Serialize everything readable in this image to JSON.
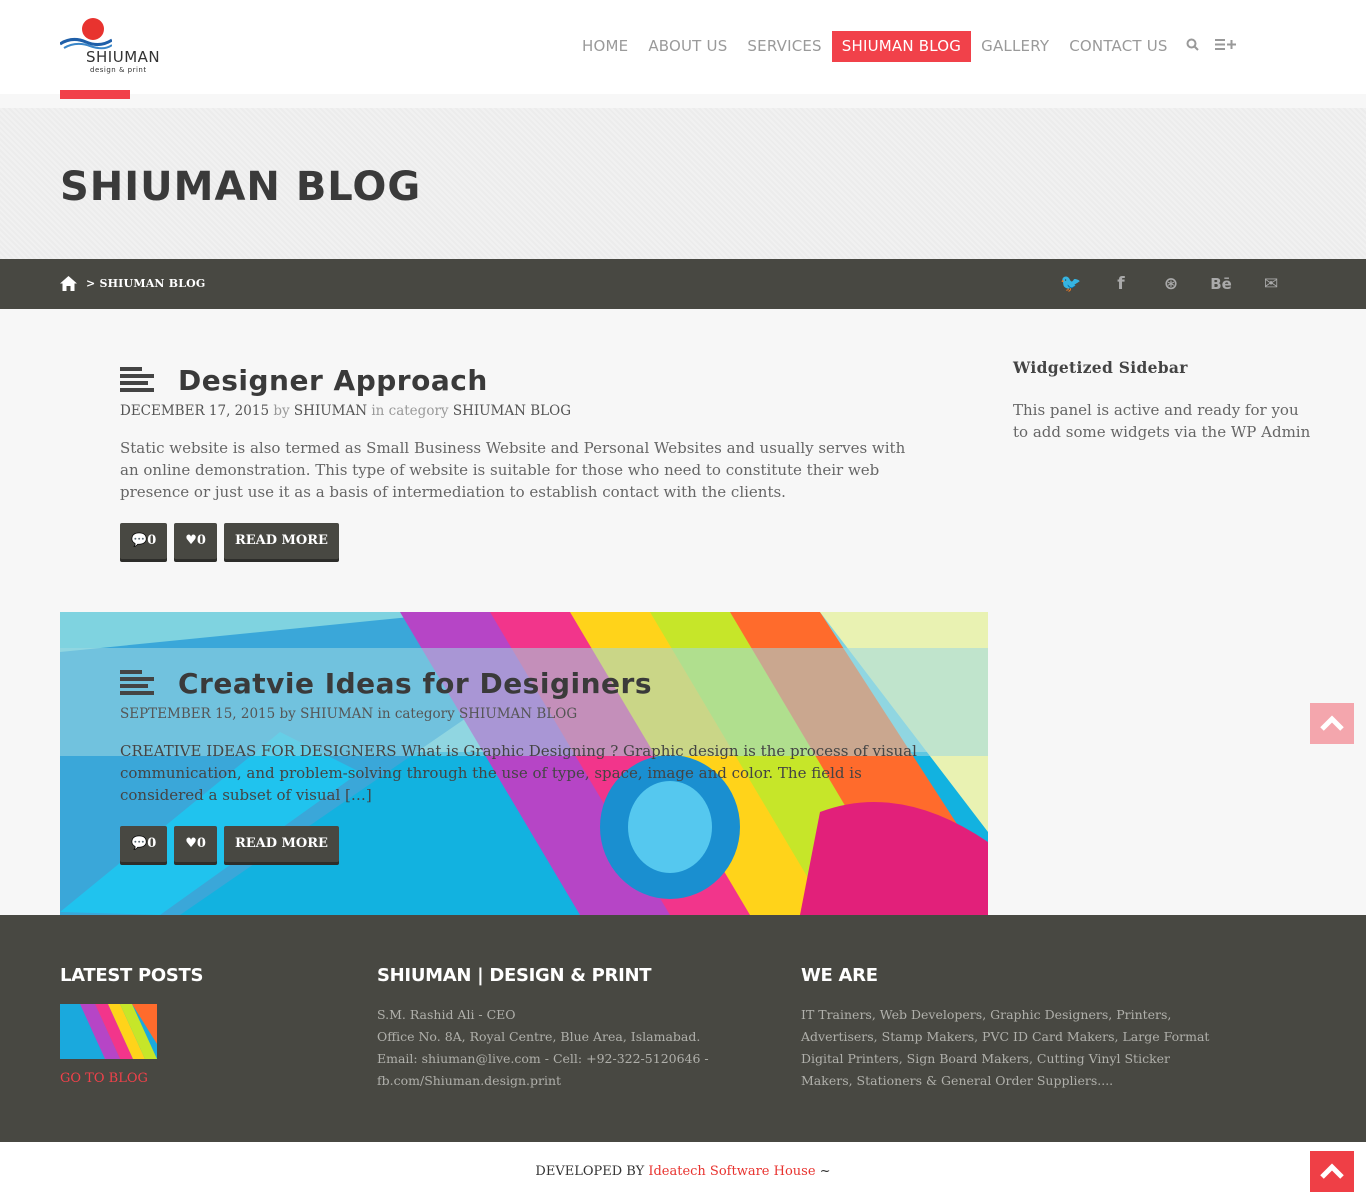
{
  "header": {
    "logo": {
      "name": "SHIUMAN",
      "tagline": "design & print"
    },
    "nav": [
      "HOME",
      "ABOUT US",
      "SERVICES",
      "SHIUMAN BLOG",
      "GALLERY",
      "CONTACT US"
    ],
    "active_nav": "SHIUMAN BLOG",
    "icons": {
      "search": "search-icon",
      "menu": "menu-plus-icon"
    }
  },
  "title_band": {
    "title": "SHIUMAN BLOG"
  },
  "breadcrumb": {
    "current": "> SHIUMAN BLOG"
  },
  "socials": [
    "twitter-icon",
    "facebook-icon",
    "dribbble-icon",
    "behance-icon",
    "mail-icon"
  ],
  "social_glyphs": {
    "twitter": "🐦",
    "facebook": "f",
    "dribbble": "⊛",
    "behance": "Bē",
    "mail": "✉"
  },
  "posts": [
    {
      "title": "Designer Approach",
      "date": "DECEMBER 17, 2015",
      "by": "by",
      "author": "SHIUMAN",
      "in_category": "in category",
      "category": "SHIUMAN BLOG",
      "excerpt": "Static website is also termed as Small Business Website and Personal Websites and usually serves with an online demonstration. This type of website is suitable for those who need to constitute their web presence or just use it as a basis of intermediation to establish contact with the clients.",
      "comments": "0",
      "likes": "0",
      "read_more": "READ MORE"
    },
    {
      "title": "Creatvie Ideas for Desiginers",
      "date": "SEPTEMBER 15, 2015",
      "by": "by",
      "author": "SHIUMAN",
      "in_category": "in category",
      "category": "SHIUMAN BLOG",
      "excerpt": "CREATIVE IDEAS FOR DESIGNERS What is Graphic Designing ? Graphic design is the process of visual communication, and problem-solving through the use of type, space, image and color. The field is considered a subset of visual […]",
      "comments": "0",
      "likes": "0",
      "read_more": "READ MORE"
    }
  ],
  "sidebar": {
    "title": "Widgetized Sidebar",
    "text": "This panel is active and ready for you to add some widgets via the WP Admin"
  },
  "footer": {
    "latest": {
      "title": "LATEST POSTS",
      "link": "GO TO BLOG"
    },
    "company": {
      "title": "SHIUMAN | DESIGN & PRINT",
      "lines": [
        "S.M. Rashid Ali - CEO",
        "Office No. 8A, Royal Centre, Blue Area, Islamabad.",
        "Email: shiuman@live.com - Cell: +92-322-5120646 -",
        "fb.com/Shiuman.design.print"
      ]
    },
    "weare": {
      "title": "WE ARE",
      "text": "IT Trainers, Web Developers, Graphic Designers, Printers, Advertisers, Stamp Makers, PVC ID Card Makers, Large Format Digital Printers, Sign Board Makers, Cutting Vinyl Sticker Makers, Stationers & General Order Suppliers...."
    }
  },
  "bottom": {
    "prefix": "DEVELOPED BY",
    "link": "Ideatech Software House",
    "suffix": "~"
  },
  "colors": {
    "accent": "#f1414a",
    "dark": "#484842"
  }
}
